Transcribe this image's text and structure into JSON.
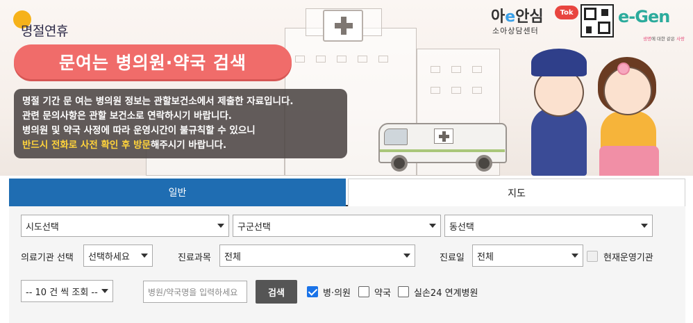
{
  "logo": {
    "text": "명절연휴"
  },
  "banner": {
    "title": "문여는 병의원·약국 검색",
    "notice_lines": [
      "명절 기간 문 여는 병의원 정보는 관할보건소에서 제출한 자료입니다.",
      "관련 문의사항은 관할 보건소로 연락하시기 바랍니다.",
      "병의원 및 약국 사정에 따라 운영시간이 불규칙할 수 있으니"
    ],
    "notice_highlight": "반드시 전화로 사전 확인 후 방문",
    "notice_tail": "해주시기 바랍니다."
  },
  "brands": {
    "brand1_pre": "아",
    "brand1_e": "e",
    "brand1_post": "안심",
    "brand1_tok": "Tok",
    "brand1_sub": "소아상담센터",
    "brand2_text": "e-Gen",
    "brand2_sub_pre": "생명",
    "brand2_sub_mid": "에 대한 같은 ",
    "brand2_sub_post": "사랑"
  },
  "tabs": [
    {
      "label": "일반",
      "active": true
    },
    {
      "label": "지도",
      "active": false
    }
  ],
  "filters": {
    "sido": "시도선택",
    "gugun": "구군선택",
    "dong": "동선택",
    "institution_label": "의료기관 선택",
    "institution_value": "선택하세요",
    "department_label": "진료과목",
    "department_value": "전체",
    "day_label": "진료일",
    "day_value": "전체",
    "operating_label": "현재운영기관",
    "page_size": "-- 10 건 씩 조회 --",
    "search_placeholder": "병원/약국명을 입력하세요",
    "search_button": "검색",
    "checkboxes": [
      {
        "label": "병·의원",
        "checked": true
      },
      {
        "label": "약국",
        "checked": false
      },
      {
        "label": "실손24 연계병원",
        "checked": false
      }
    ]
  },
  "colors": {
    "tab_active": "#1f6db2",
    "title_pill": "#f06c6a",
    "highlight": "#ffd33b",
    "checkbox_checked": "#1a73e8"
  }
}
